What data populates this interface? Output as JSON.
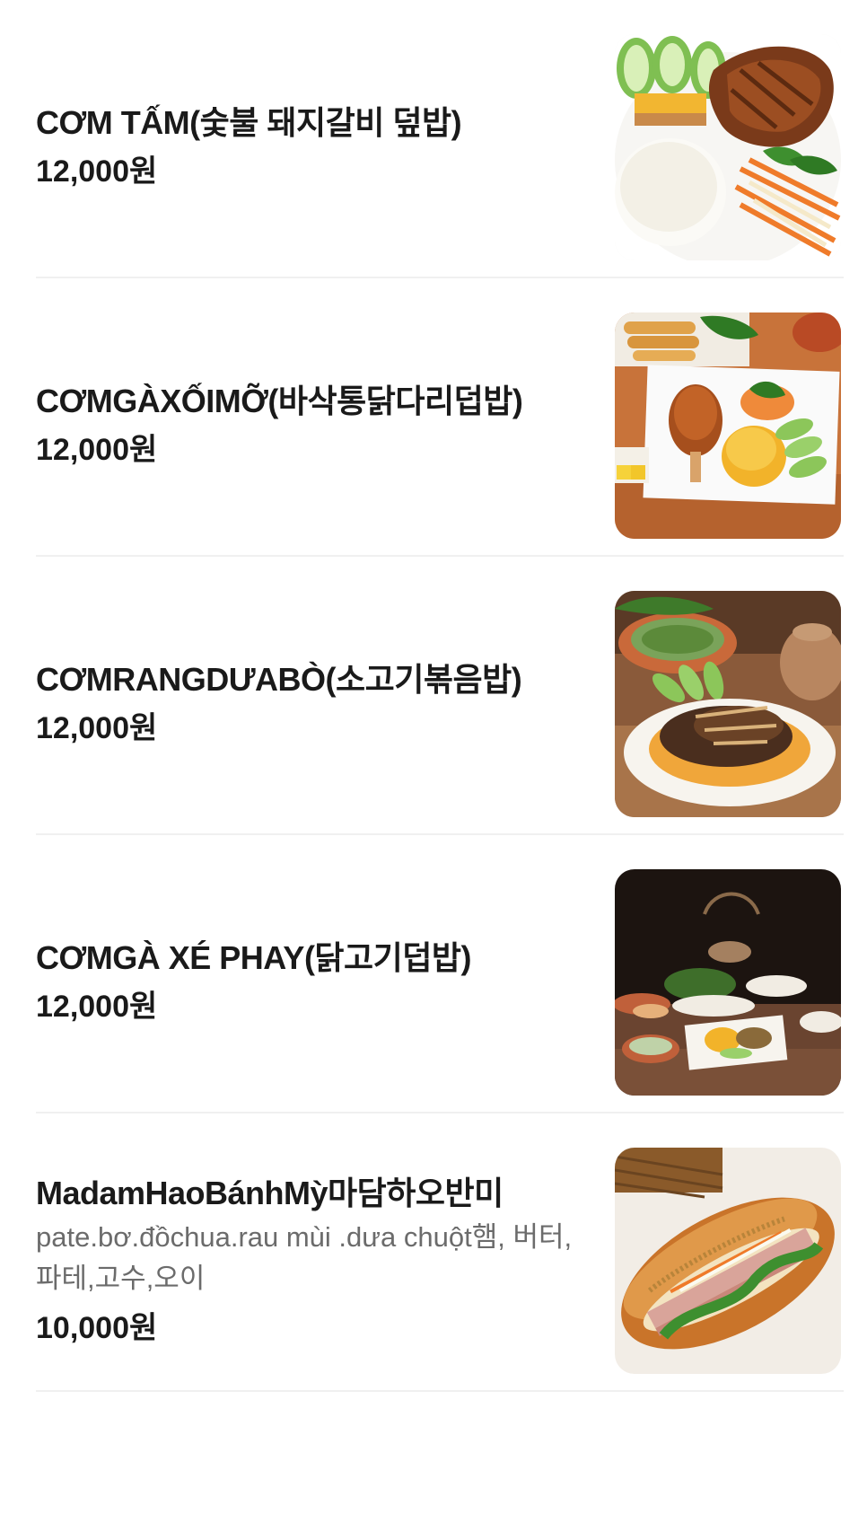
{
  "menu": {
    "items": [
      {
        "name": "CƠM TẤM(숯불 돼지갈비 덮밥)",
        "description": "",
        "price": "12,000원",
        "image": "com-tam-grilled-pork-rice"
      },
      {
        "name": "CƠMGÀXỐIMỠ(바삭통닭다리덥밥)",
        "description": "",
        "price": "12,000원",
        "image": "crispy-chicken-leg-turmeric-rice"
      },
      {
        "name": "CƠMRANGDƯABÒ(소고기볶음밥)",
        "description": "",
        "price": "12,000원",
        "image": "beef-fried-rice"
      },
      {
        "name": "CƠMGÀ XÉ PHAY(닭고기덥밥)",
        "description": "",
        "price": "12,000원",
        "image": "shredded-chicken-rice-table"
      },
      {
        "name": "MadamHaoBánhMỳ마담하오반미",
        "description": "pate.bơ.đồchua.rau mùi .dưa chuột햄, 버터,파테,고수,오이",
        "price": "10,000원",
        "image": "banh-mi-sandwich"
      }
    ]
  },
  "colors": {
    "text_primary": "#1a1a1a",
    "text_secondary": "#6b6b6b",
    "divider": "#f0f0f0",
    "background": "#ffffff"
  }
}
